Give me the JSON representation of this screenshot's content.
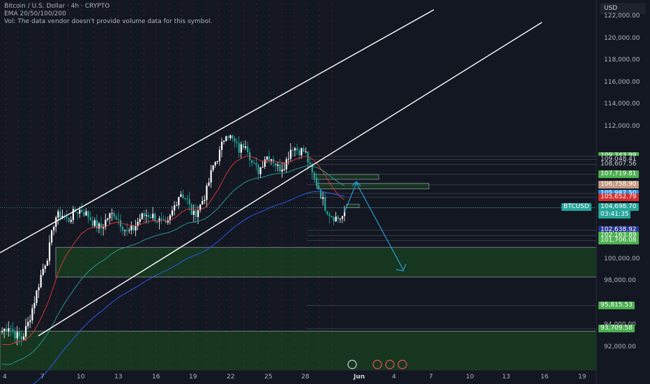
{
  "legend": {
    "symbol_line": "Bitcoin / U.S. Dollar · 4h · CRYPTO",
    "ema_line": "EMA 20/50/100/200",
    "vol_line": "Vol: The data vendor doesn't provide volume data for this symbol."
  },
  "currency_button": "USD",
  "price_axis": {
    "labels": [
      "122,000.00",
      "120,000.00",
      "118,000.00",
      "116,000.00",
      "114,000.00",
      "112,000.00",
      "100,000.00",
      "98,000.00",
      "94,000.00",
      "92,000.00"
    ],
    "values": [
      122000,
      120000,
      118000,
      116000,
      114000,
      112000,
      100000,
      98000,
      94000,
      92000
    ]
  },
  "price_tags": [
    {
      "text": "109,343.99",
      "color": "#4caf50",
      "price": 109344
    },
    {
      "text": "109,048.41",
      "color": "#131722",
      "price": 109048
    },
    {
      "text": "108,607.56",
      "color": "#131722",
      "price": 108608
    },
    {
      "text": "107,719.81",
      "color": "#4caf50",
      "price": 107720
    },
    {
      "text": "106,758.90",
      "color": "#c49a82",
      "price": 106759
    },
    {
      "text": "105,987.50",
      "color": "#2196f3",
      "price": 105987
    },
    {
      "text": "105,652.79",
      "color": "#d32f2f",
      "price": 105653
    },
    {
      "text": "102,638.92",
      "color": "#283593",
      "price": 102639
    },
    {
      "text": "102,163.89",
      "color": "#4caf50",
      "price": 102164
    },
    {
      "text": "101,706.08",
      "color": "#4caf50",
      "price": 101706
    },
    {
      "text": "95,815.53",
      "color": "#4caf50",
      "price": 95816
    },
    {
      "text": "93,709.58",
      "color": "#4caf50",
      "price": 93710
    }
  ],
  "current_price": {
    "symbol": "BTCUSD",
    "price": "104,698.70",
    "countdown": "03:41:35",
    "value": 104699,
    "color": "#26a69a"
  },
  "time_axis": {
    "labels": [
      "4",
      "7",
      "10",
      "13",
      "16",
      "19",
      "22",
      "25",
      "28",
      "Jun",
      "4",
      "7",
      "10",
      "13",
      "16",
      "19"
    ],
    "bold_label": "Jun"
  },
  "colors": {
    "background": "#131722",
    "up": "#ffffff",
    "down": "#26a69a",
    "ema20": "#e53935",
    "ema50": "#26a69a",
    "ema100": "#2962ff",
    "zone": "#1b5e20",
    "projection": "#29b6f6",
    "channel": "#ffffff",
    "session_dots": "#7b1f2e"
  },
  "chart_data": {
    "type": "candlestick",
    "title": "Bitcoin / U.S. Dollar · 4h · CRYPTO",
    "ylim": [
      90500,
      124000
    ],
    "x_ticks": [
      "4",
      "7",
      "10",
      "13",
      "16",
      "19",
      "22",
      "25",
      "28",
      "Jun",
      "4",
      "7",
      "10",
      "13",
      "16",
      "19"
    ],
    "close_path": [
      93500,
      94000,
      93200,
      92800,
      94300,
      96500,
      98800,
      100500,
      103800,
      104100,
      103500,
      104300,
      104500,
      104000,
      103200,
      102800,
      103800,
      104200,
      103300,
      102400,
      102800,
      103800,
      104100,
      103900,
      103400,
      102900,
      104600,
      106100,
      105500,
      103900,
      104800,
      106100,
      108400,
      109600,
      111600,
      110800,
      109900,
      110700,
      108600,
      108000,
      109400,
      109200,
      108200,
      108700,
      110300,
      109900,
      109800,
      107800,
      106600,
      104800,
      104000,
      103700,
      104000
    ],
    "price_levels": [
      109344,
      109048,
      108608,
      107720,
      106759,
      105987,
      105653,
      104699,
      102639,
      102164,
      101706,
      95816,
      93710
    ],
    "zones": [
      [
        98400,
        101100
      ],
      [
        90500,
        93500
      ]
    ],
    "annotations": [
      "channel-upper",
      "channel-lower",
      "projection-arrow"
    ]
  }
}
